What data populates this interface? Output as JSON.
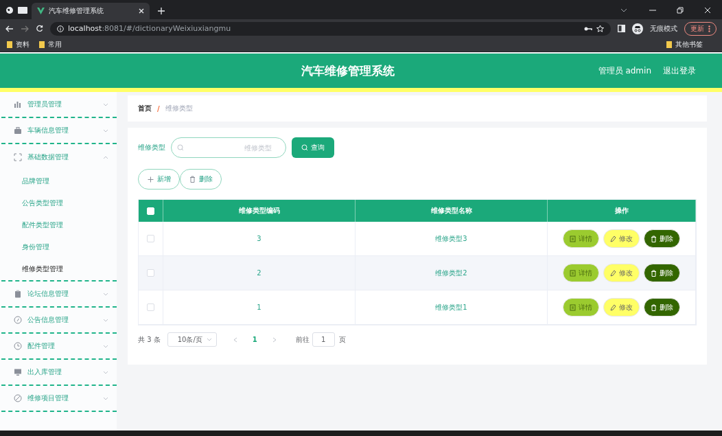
{
  "browser": {
    "tab_title": "汽车维修管理系统",
    "url_host": "localhost",
    "url_path": ":8081/#/dictionaryWeixiuxiangmu",
    "profile_label": "无痕模式",
    "update_button": "更新",
    "bookmarks": [
      "资料",
      "常用"
    ],
    "other_bookmarks": "其他书签"
  },
  "header": {
    "title": "汽车维修管理系统",
    "user": "管理员 admin",
    "logout": "退出登录"
  },
  "sidebar": {
    "items": [
      {
        "label": "管理员管理",
        "expanded": false
      },
      {
        "label": "车辆信息管理",
        "expanded": false
      },
      {
        "label": "基础数据管理",
        "expanded": true,
        "children": [
          {
            "label": "品牌管理",
            "selected": false
          },
          {
            "label": "公告类型管理",
            "selected": false
          },
          {
            "label": "配件类型管理",
            "selected": false
          },
          {
            "label": "身份管理",
            "selected": false
          },
          {
            "label": "维修类型管理",
            "selected": true
          }
        ]
      },
      {
        "label": "论坛信息管理",
        "expanded": false
      },
      {
        "label": "公告信息管理",
        "expanded": false
      },
      {
        "label": "配件管理",
        "expanded": false
      },
      {
        "label": "出入库管理",
        "expanded": false
      },
      {
        "label": "维修项目管理",
        "expanded": false
      }
    ]
  },
  "breadcrumb": [
    "首页",
    "维修类型"
  ],
  "breadcrumb_separator": "/",
  "search": {
    "label": "维修类型",
    "placeholder": "维修类型",
    "button": "查询"
  },
  "actions": [
    {
      "label": "新增",
      "kind": "add"
    },
    {
      "label": "删除",
      "kind": "delete"
    }
  ],
  "table": {
    "columns": [
      "维修类型编码",
      "维修类型名称",
      "操作"
    ],
    "all_checked": false,
    "rows": [
      {
        "code": "3",
        "name": "维修类型3",
        "checked": false,
        "actions": [
          {
            "kind": "detail",
            "label": "详情"
          },
          {
            "kind": "edit",
            "label": "修改"
          },
          {
            "kind": "delete",
            "label": "删除"
          }
        ]
      },
      {
        "code": "2",
        "name": "维修类型2",
        "checked": false,
        "actions": [
          {
            "kind": "detail",
            "label": "详情"
          },
          {
            "kind": "edit",
            "label": "修改"
          },
          {
            "kind": "delete",
            "label": "删除"
          }
        ]
      },
      {
        "code": "1",
        "name": "维修类型1",
        "checked": false,
        "actions": [
          {
            "kind": "detail",
            "label": "详情"
          },
          {
            "kind": "edit",
            "label": "修改"
          },
          {
            "kind": "delete",
            "label": "删除"
          }
        ]
      }
    ]
  },
  "pagination": {
    "total": "共 3 条",
    "page_size": "10条/页",
    "current": "1",
    "goto_label": "前往",
    "goto_value": "1",
    "page_suffix": "页"
  }
}
